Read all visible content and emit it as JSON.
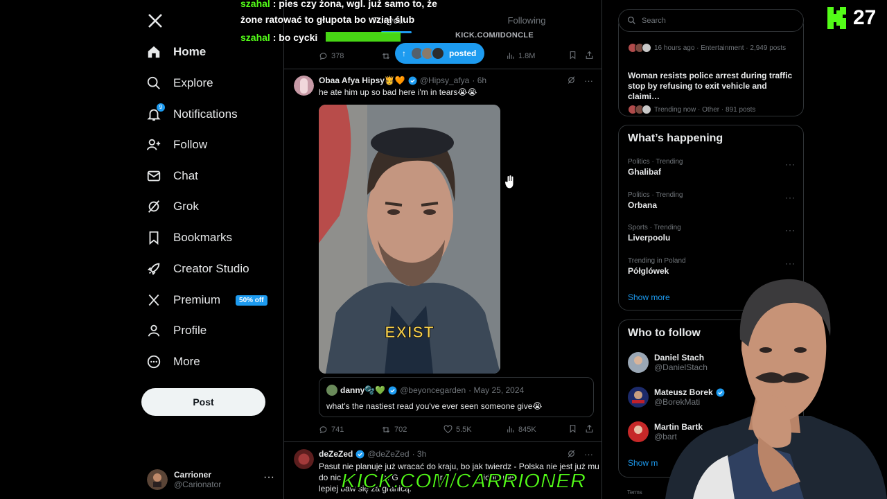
{
  "sidebar": {
    "nav": [
      {
        "label": "Home",
        "icon": "home-icon"
      },
      {
        "label": "Explore",
        "icon": "search-icon"
      },
      {
        "label": "Notifications",
        "icon": "bell-icon",
        "badge": "9"
      },
      {
        "label": "Follow",
        "icon": "follow-icon"
      },
      {
        "label": "Chat",
        "icon": "mail-icon"
      },
      {
        "label": "Grok",
        "icon": "grok-icon"
      },
      {
        "label": "Bookmarks",
        "icon": "bookmark-icon"
      },
      {
        "label": "Creator Studio",
        "icon": "rocket-icon"
      },
      {
        "label": "Premium",
        "icon": "x-icon",
        "promo": "50% off"
      },
      {
        "label": "Profile",
        "icon": "person-icon"
      },
      {
        "label": "More",
        "icon": "more-circle-icon"
      }
    ],
    "post_button": "Post",
    "account": {
      "name": "Carrioner",
      "handle": "@Carionator",
      "more": "···"
    }
  },
  "feed": {
    "tabs": [
      "For you",
      "Following"
    ],
    "kick_strip_text": "KICK.COM/IDONCLE",
    "posted_pill": "posted",
    "first_actions": {
      "replies": "378",
      "views": "1.8M"
    },
    "tweet1": {
      "name": "Obaa Afya Hipsy🫅🧡",
      "handle": "@Hipsy_afya",
      "time": "· 6h",
      "text": "he ate him up so bad here i'm in tears😭😭",
      "caption": "EXIST",
      "quote": {
        "name": "danny🫧💚",
        "handle": "@beyoncegarden",
        "date": "· May 25, 2024",
        "text": "what's the nastiest read you've ever seen someone give😭"
      },
      "actions": {
        "replies": "741",
        "reposts": "702",
        "likes": "5.5K",
        "views": "845K"
      }
    },
    "tweet2": {
      "name": "deZeZed",
      "handle": "@deZeZed",
      "time": "· 3h",
      "line1": "Pasut nie planuje już wracać do kraju, bo jak twierdz - Polska nie jest już mu",
      "line2": "do nic                 ta. G                ar               widoczniej",
      "line3": "lepiej baw się za granicą."
    }
  },
  "right": {
    "search_placeholder": "Search",
    "news": [
      {
        "title": "",
        "meta": "16 hours ago · Entertainment · 2,949 posts"
      },
      {
        "title": "Woman resists police arrest during traffic stop by refusing to exit vehicle and claimi…",
        "meta": "Trending now · Other · 891 posts"
      }
    ],
    "happening_title": "What’s happening",
    "trends": [
      {
        "cat": "Politics · Trending",
        "name": "Ghalibaf"
      },
      {
        "cat": "Politics · Trending",
        "name": "Orbana"
      },
      {
        "cat": "Sports · Trending",
        "name": "Liverpoolu"
      },
      {
        "cat": "Trending in Poland",
        "name": "Półglówek"
      }
    ],
    "show_more": "Show more",
    "who_title": "Who to follow",
    "who": [
      {
        "name": "Daniel Stach",
        "handle": "@DanielStach"
      },
      {
        "name": "Mateusz Borek",
        "handle": "@BorekMati"
      },
      {
        "name": "Martin Bartk",
        "handle": "@bart"
      }
    ],
    "show_more_2": "Show m",
    "terms": "Terms"
  },
  "overlay": {
    "chat": [
      {
        "user": "szahal",
        "text": " : pies czy żona, wgl. już samo to, że"
      },
      {
        "user": "",
        "text": "żone ratować to głupota bo wziął ślub"
      },
      {
        "user": "szahal",
        "text": " : bo cycki"
      }
    ],
    "kick_count": "27",
    "kick_banner": "KICK.COM/CARRIONER"
  },
  "colors": {
    "accent": "#1d9bf0",
    "kick_green": "#53fc18",
    "border": "#2f3336",
    "muted": "#71767b"
  }
}
